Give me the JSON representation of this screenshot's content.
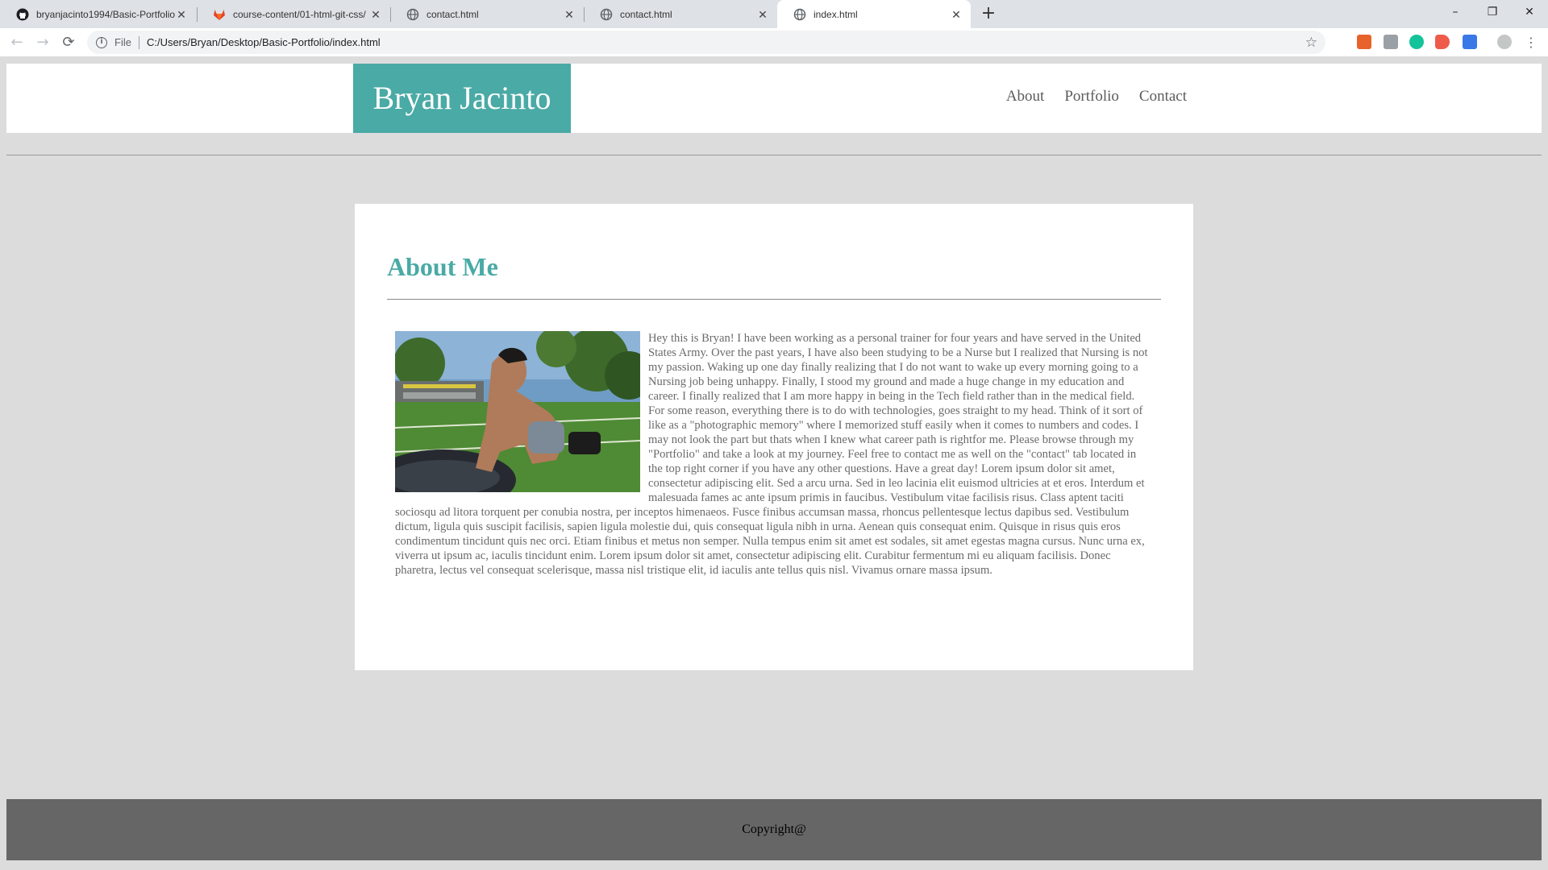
{
  "browser": {
    "tabs": [
      {
        "title": "bryanjacinto1994/Basic-Portfolio",
        "icon": "github-icon"
      },
      {
        "title": "course-content/01-html-git-css/",
        "icon": "gitlab-icon"
      },
      {
        "title": "contact.html",
        "icon": "globe-icon"
      },
      {
        "title": "contact.html",
        "icon": "globe-icon"
      },
      {
        "title": "index.html",
        "icon": "globe-icon",
        "active": true
      }
    ],
    "new_tab_label": "+",
    "window_controls": {
      "minimize": "–",
      "restore": "❐",
      "close": "✕"
    },
    "address": {
      "scheme_label": "File",
      "url": "C:/Users/Bryan/Desktop/Basic-Portfolio/index.html"
    }
  },
  "site": {
    "brand": "Bryan Jacinto",
    "nav": [
      "About",
      "Portfolio",
      "Contact"
    ],
    "colors": {
      "accent": "#4aaaa5",
      "footer": "#666666",
      "background": "#dcdcdc"
    }
  },
  "about": {
    "title": "About Me",
    "photo_alt": "profile-photo",
    "body": "Hey this is Bryan! I have been working as a personal trainer for four years and have served in the United States Army. Over the past years, I have also been studying to be a Nurse but I realized that Nursing is not my passion. Waking up one day finally realizing that I do not want to wake up every morning going to a Nursing job being unhappy. Finally, I stood my ground and made a huge change in my education and career. I finally realized that I am more happy in being in the Tech field rather than in the medical field. For some reason, everything there is to do with technologies, goes straight to my head. Think of it sort of like as a \"photographic memory\" where I memorized stuff easily when it comes to numbers and codes. I may not look the part but thats when I knew what career path is rightfor me. Please browse through my \"Portfolio\" and take a look at my journey. Feel free to contact me as well on the \"contact\" tab located in the top right corner if you have any other questions. Have a great day! Lorem ipsum dolor sit amet, consectetur adipiscing elit. Sed a arcu urna. Sed in leo lacinia elit euismod ultricies at et eros. Interdum et malesuada fames ac ante ipsum primis in faucibus. Vestibulum vitae facilisis risus. Class aptent taciti sociosqu ad litora torquent per conubia nostra, per inceptos himenaeos. Fusce finibus accumsan massa, rhoncus pellentesque lectus dapibus sed. Vestibulum dictum, ligula quis suscipit facilisis, sapien ligula molestie dui, quis consequat ligula nibh in urna. Aenean quis consequat enim. Quisque in risus quis eros condimentum tincidunt quis nec orci. Etiam finibus et metus non semper. Nulla tempus enim sit amet est sodales, sit amet egestas magna cursus. Nunc urna ex, viverra ut ipsum ac, iaculis tincidunt enim. Lorem ipsum dolor sit amet, consectetur adipiscing elit. Curabitur fermentum mi eu aliquam facilisis. Donec pharetra, lectus vel consequat scelerisque, massa nisl tristique elit, id iaculis ante tellus quis nisl. Vivamus ornare massa ipsum."
  },
  "footer": {
    "copyright": "Copyright@"
  }
}
